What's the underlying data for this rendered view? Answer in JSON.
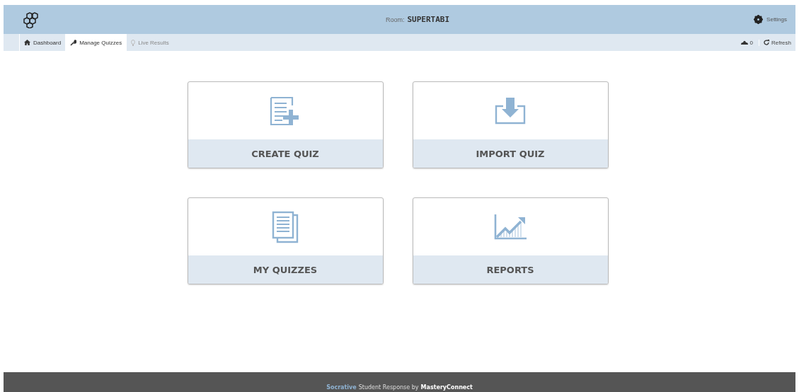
{
  "header": {
    "room_label": "Room:",
    "room_name": "SUPERTABI",
    "settings": "Settings"
  },
  "tabs": [
    {
      "label": "Dashboard",
      "selected": false,
      "disabled": false
    },
    {
      "label": "Manage Quizzes",
      "selected": true,
      "disabled": false
    },
    {
      "label": "Live Results",
      "selected": false,
      "disabled": true
    }
  ],
  "student_count": "0",
  "refresh": "Refresh",
  "tiles": [
    {
      "kind": "create",
      "label": "CREATE QUIZ"
    },
    {
      "kind": "import",
      "label": "IMPORT QUIZ"
    },
    {
      "kind": "list",
      "label": "MY QUIZZES"
    },
    {
      "kind": "chart",
      "label": "REPORTS"
    }
  ],
  "footer": {
    "brand": "Socrative",
    "text": "Student Response by",
    "company": "MasteryConnect"
  }
}
